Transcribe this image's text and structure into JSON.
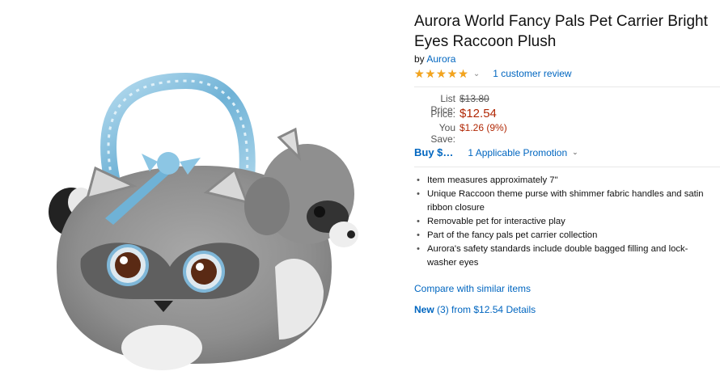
{
  "product": {
    "title": "Aurora World Fancy Pals Pet Carrier Bright Eyes Raccoon Plush",
    "by_prefix": "by",
    "brand": "Aurora",
    "rating_icon": "five-star-rating-icon",
    "rating_stars": 5,
    "review_link": "1 customer review"
  },
  "pricing": {
    "list_price_label": "List Price:",
    "list_price": "$13.80",
    "price_label": "Price:",
    "price": "$12.54",
    "you_save_label": "You Save:",
    "you_save": "$1.26 (9%)"
  },
  "promotion": {
    "buy_label": "Buy $…",
    "promo_label": "1 Applicable Promotion"
  },
  "bullets": [
    "Item measures approximately 7\"",
    "Unique Raccoon theme purse with shimmer fabric handles and satin",
    "ribbon closure",
    "Removable pet for interactive play",
    "Part of the fancy pals pet carrier collection",
    "Aurora's safety standards include double bagged filling and lock-",
    "washer eyes"
  ],
  "links": {
    "compare": "Compare with similar items",
    "new_label": "New",
    "new_count": "(3)",
    "new_from": "from $12.54",
    "details": "Details"
  },
  "colors": {
    "link": "#0066c0",
    "price": "#b12704",
    "star": "#f4a41d"
  }
}
